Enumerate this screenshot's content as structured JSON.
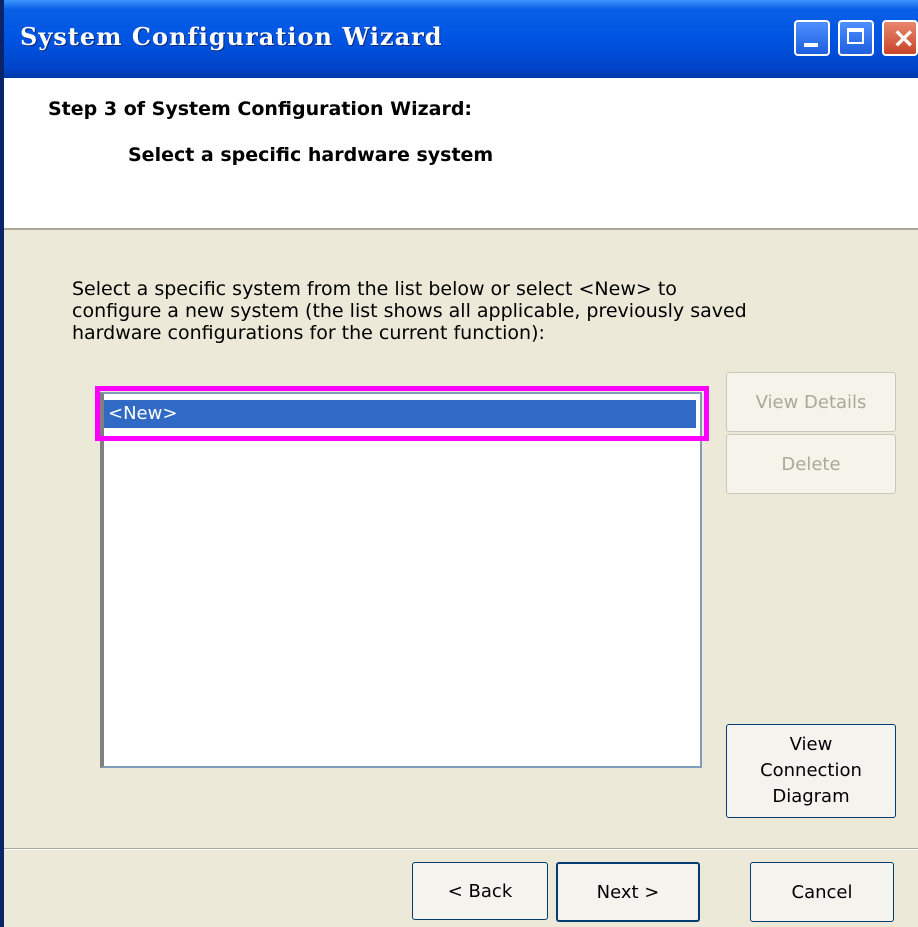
{
  "window": {
    "title": "System Configuration Wizard"
  },
  "header": {
    "step_title": "Step 3 of System Configuration Wizard:",
    "step_subtitle": "Select a specific hardware system"
  },
  "body": {
    "instructions": "Select a specific system from the list below or select <New> to configure a new system (the list shows all applicable, previously saved hardware configurations for the current function):"
  },
  "systems_list": {
    "items": [
      {
        "label": "<New>",
        "selected": true
      }
    ]
  },
  "side_buttons": {
    "view_details": "View Details",
    "delete": "Delete",
    "diagram_line1": "View",
    "diagram_line2": "Connection",
    "diagram_line3": "Diagram"
  },
  "footer": {
    "back": "< Back",
    "next": "Next >",
    "cancel": "Cancel"
  },
  "colors": {
    "selection": "#316ac5",
    "highlight_annotation": "#ff00ff",
    "titlebar": "#0054e3",
    "dialog_bg": "#ece9d8"
  }
}
